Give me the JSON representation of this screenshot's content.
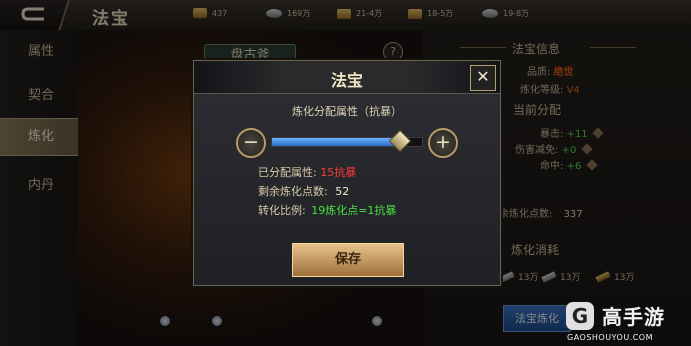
{
  "header": {
    "title": "法宝",
    "resources": [
      {
        "icon": "gold-ingot-icon",
        "value": "437"
      },
      {
        "icon": "silver-coin-icon",
        "value": "169万"
      },
      {
        "icon": "scroll-icon",
        "value": "21-4万"
      },
      {
        "icon": "gold-ore-icon",
        "value": "18-5万"
      },
      {
        "icon": "feather-icon",
        "value": "19-8万"
      }
    ]
  },
  "nav": {
    "items": [
      {
        "label": "属性",
        "active": false
      },
      {
        "label": "契合",
        "active": false
      },
      {
        "label": "炼化",
        "active": true
      },
      {
        "label": "内丹",
        "active": false
      }
    ]
  },
  "scene": {
    "name": "盘古斧",
    "help": "?"
  },
  "right": {
    "info_title": "法宝信息",
    "quality_label": "品质:",
    "quality_value": "绝世",
    "refine_level_label": "炼化等级:",
    "refine_level_value": "V4",
    "current_alloc_title": "当前分配",
    "stats": [
      {
        "label": "暴击:",
        "value": "+11"
      },
      {
        "label": "伤害减免:",
        "value": "+0"
      },
      {
        "label": "命中:",
        "value": "+6"
      }
    ],
    "remaining_label": "余炼化点数:",
    "remaining_value": "337",
    "cost_title": "炼化消耗",
    "costs": [
      "13万",
      "13万",
      "13万"
    ],
    "refine_button": "法宝炼化"
  },
  "modal": {
    "title": "法宝",
    "close": "✕",
    "attr_title": "炼化分配属性（抗暴）",
    "minus": "−",
    "plus": "+",
    "slider_value": 0.85,
    "allocated_label": "已分配属性:",
    "allocated_value": "15抗暴",
    "remaining_label": "剩余炼化点数:",
    "remaining_value": "52",
    "ratio_label": "转化比例:",
    "ratio_value": "19炼化点=1抗暴",
    "save_button": "保存"
  },
  "watermark": {
    "logo": "G",
    "text": "高手游",
    "domain": "GAOSHOUYOU.COM"
  },
  "colors": {
    "accent_blue": "#2c6cc9",
    "highlight_red": "#ff3a3a",
    "highlight_green": "#49e143",
    "gold": "#e6c28b"
  }
}
